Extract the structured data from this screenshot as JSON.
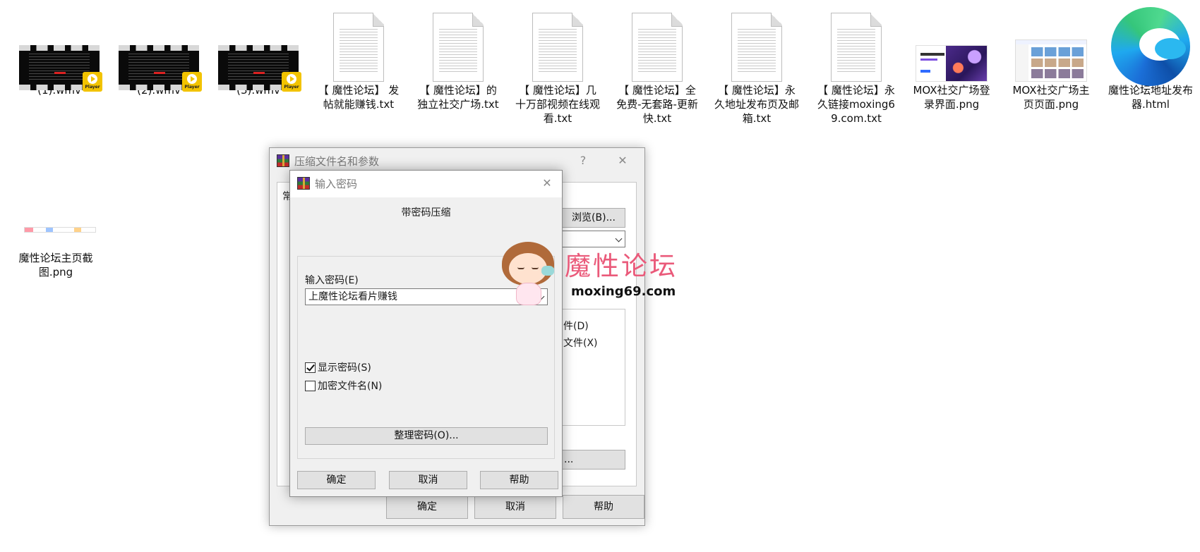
{
  "desktop": {
    "icons": [
      {
        "label": "(1).wmv",
        "badge": "Player"
      },
      {
        "label": "(2).wmv",
        "badge": "Player"
      },
      {
        "label": "(3).wmv",
        "badge": "Player"
      },
      {
        "label": "【 魔性论坛】 发帖就能赚钱.txt"
      },
      {
        "label": "【 魔性论坛】的独立社交广场.txt"
      },
      {
        "label": "【 魔性论坛】几十万部视频在线观看.txt"
      },
      {
        "label": "【 魔性论坛】全免费-无套路-更新快.txt"
      },
      {
        "label": "【 魔性论坛】永久地址发布页及邮箱.txt"
      },
      {
        "label": "【 魔性论坛】永久链接moxing69.com.txt"
      },
      {
        "label": "MOX社交广场登录界面.png"
      },
      {
        "label": "MOX社交广场主页页面.png"
      },
      {
        "label": "魔性论坛地址发布器.html"
      },
      {
        "label": "魔性论坛主页截图.png"
      }
    ]
  },
  "back_dialog": {
    "title": "压缩文件名和参数",
    "help_glyph": "?",
    "close_glyph": "✕",
    "tab_partial": "常",
    "browse_button": "浏览(B)...",
    "option_fragment_1": "件(D)",
    "option_fragment_2": "文件(X)",
    "lower_button_fragment": "...",
    "ok_button": "确定",
    "cancel_button": "取消",
    "help_button": "帮助"
  },
  "password_dialog": {
    "title": "输入密码",
    "close_glyph": "✕",
    "heading": "带密码压缩",
    "password_label": "输入密码(E)",
    "password_value": "上魔性论坛看片赚钱",
    "show_password_label": "显示密码(S)",
    "show_password_checked": true,
    "encrypt_names_label": "加密文件名(N)",
    "encrypt_names_checked": false,
    "organize_button": "整理密码(O)...",
    "ok_button": "确定",
    "cancel_button": "取消",
    "help_button": "帮助"
  },
  "watermark": {
    "title": "魔性论坛",
    "url": "moxing69.com"
  }
}
